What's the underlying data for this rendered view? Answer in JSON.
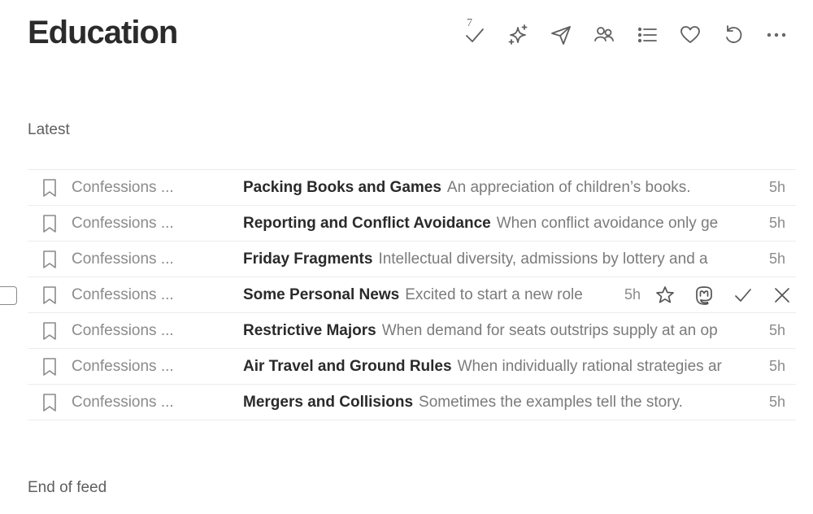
{
  "page": {
    "title": "Education"
  },
  "toolbar": {
    "mark_read_count": "7",
    "buttons": [
      "mark-all-read",
      "sparkle",
      "send",
      "community",
      "list",
      "favorite",
      "refresh",
      "more"
    ]
  },
  "section": {
    "label": "Latest"
  },
  "feed": {
    "items": [
      {
        "source": "Confessions ...",
        "headline": "Packing Books and Games",
        "summary": "An appreciation of children’s books.",
        "time": "5h"
      },
      {
        "source": "Confessions ...",
        "headline": "Reporting and Conflict Avoidance",
        "summary": "When conflict avoidance only ge",
        "time": "5h"
      },
      {
        "source": "Confessions ...",
        "headline": "Friday Fragments",
        "summary": "Intellectual diversity, admissions by lottery and a",
        "time": "5h"
      },
      {
        "source": "Confessions ...",
        "headline": "Some Personal News",
        "summary": "Excited to start a new role",
        "time": "5h",
        "hovered": true
      },
      {
        "source": "Confessions ...",
        "headline": "Restrictive Majors",
        "summary": "When demand for seats outstrips supply at an op",
        "time": "5h"
      },
      {
        "source": "Confessions ...",
        "headline": "Air Travel and Ground Rules",
        "summary": "When individually rational strategies ar",
        "time": "5h"
      },
      {
        "source": "Confessions ...",
        "headline": "Mergers and Collisions",
        "summary": "Sometimes the examples tell the story.",
        "time": "5h"
      }
    ]
  },
  "footer": {
    "end_label": "End of feed"
  }
}
